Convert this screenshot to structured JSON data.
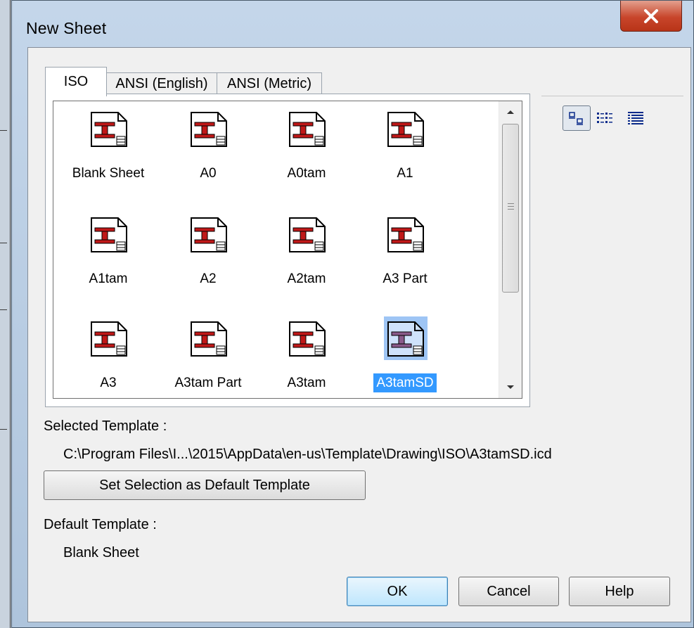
{
  "window": {
    "title": "New Sheet"
  },
  "tabs": [
    {
      "label": "ISO",
      "active": true
    },
    {
      "label": "ANSI (English)",
      "active": false
    },
    {
      "label": "ANSI (Metric)",
      "active": false
    }
  ],
  "templates": [
    {
      "label": "Blank Sheet",
      "selected": false
    },
    {
      "label": "A0",
      "selected": false
    },
    {
      "label": "A0tam",
      "selected": false
    },
    {
      "label": "A1",
      "selected": false
    },
    {
      "label": "A1tam",
      "selected": false
    },
    {
      "label": "A2",
      "selected": false
    },
    {
      "label": "A2tam",
      "selected": false
    },
    {
      "label": "A3 Part",
      "selected": false
    },
    {
      "label": "A3",
      "selected": false
    },
    {
      "label": "A3tam Part",
      "selected": false
    },
    {
      "label": "A3tam",
      "selected": false
    },
    {
      "label": "A3tamSD",
      "selected": true
    }
  ],
  "view_modes": [
    "large-icons-view-icon",
    "list-view-icon",
    "details-view-icon"
  ],
  "selected_template": {
    "label": "Selected Template :",
    "path": "C:\\Program Files\\I...\\2015\\AppData\\en-us\\Template\\Drawing\\ISO\\A3tamSD.icd"
  },
  "set_default_button": "Set Selection as Default Template",
  "default_template": {
    "label": "Default Template :",
    "value": "Blank Sheet"
  },
  "buttons": {
    "ok": "OK",
    "cancel": "Cancel",
    "help": "Help"
  },
  "colors": {
    "selection": "#3399ff",
    "icon_red": "#c01818",
    "close": "#c8452b"
  }
}
